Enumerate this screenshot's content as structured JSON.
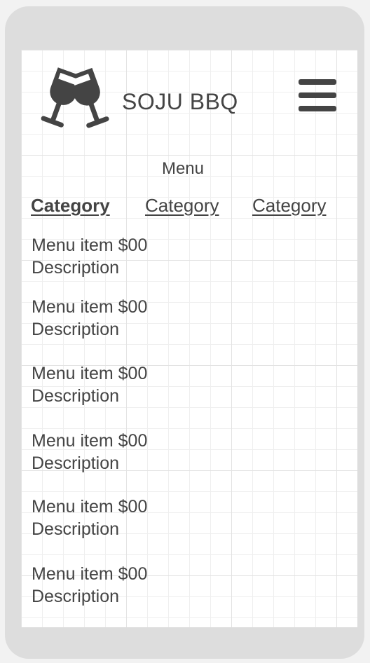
{
  "header": {
    "brand": "SOJU BBQ",
    "logo_icon": "glasses-cheers-icon",
    "menu_icon": "hamburger-menu-icon"
  },
  "menu": {
    "heading": "Menu",
    "tabs": [
      {
        "label": "Category",
        "active": true
      },
      {
        "label": "Category",
        "active": false
      },
      {
        "label": "Category",
        "active": false
      }
    ],
    "items": [
      {
        "title": "Menu item $00",
        "description": "Description"
      },
      {
        "title": "Menu item $00",
        "description": "Description"
      },
      {
        "title": "Menu item $00",
        "description": "Description"
      },
      {
        "title": "Menu item $00",
        "description": "Description"
      },
      {
        "title": "Menu item $00",
        "description": "Description"
      },
      {
        "title": "Menu item $00",
        "description": "Description"
      }
    ]
  },
  "colors": {
    "text": "#444444",
    "device_frame": "#dddddd",
    "screen_bg": "#ffffff",
    "grid": "#e3e3e3"
  }
}
